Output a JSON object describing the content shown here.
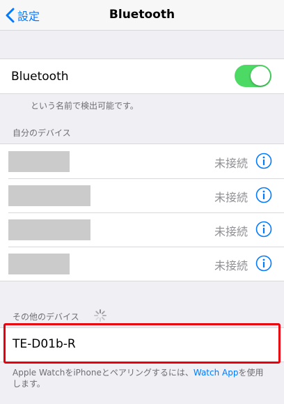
{
  "nav": {
    "back_label": "設定",
    "title": "Bluetooth"
  },
  "bluetooth": {
    "label": "Bluetooth",
    "enabled": true,
    "discoverable_note": "という名前で検出可能です。"
  },
  "my_devices": {
    "header": "自分のデバイス",
    "items": [
      {
        "status": "未接続"
      },
      {
        "status": "未接続"
      },
      {
        "status": "未接続"
      },
      {
        "status": "未接続"
      }
    ]
  },
  "other_devices": {
    "header": "その他のデバイス",
    "items": [
      {
        "name": "TE-D01b-R"
      }
    ]
  },
  "footer": {
    "text_before": "Apple WatchをiPhoneとペアリングするには、",
    "link": "Watch App",
    "text_after": "を使用します。"
  },
  "colors": {
    "accent": "#007aff",
    "toggle_on": "#4cd964",
    "highlight": "#e8000f"
  }
}
